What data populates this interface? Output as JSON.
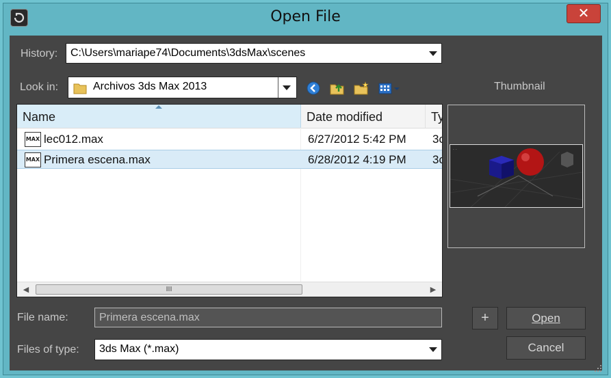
{
  "window": {
    "title": "Open File",
    "close_glyph": "✕",
    "app_icon": "3ds-max-app-icon"
  },
  "history": {
    "label": "History:",
    "value": "C:\\Users\\mariape74\\Documents\\3dsMax\\scenes"
  },
  "look_in": {
    "label": "Look in:",
    "value": "Archivos 3ds Max 2013",
    "folder_icon": "folder-icon"
  },
  "toolbar": {
    "icons": [
      "back-icon",
      "up-folder-icon",
      "new-folder-icon",
      "view-menu-icon"
    ]
  },
  "file_list": {
    "columns": [
      "Name",
      "Date modified",
      "Ty"
    ],
    "rows": [
      {
        "name": "lec012.max",
        "date": "6/27/2012 5:42 PM",
        "type": "3c",
        "icon_text": "MAX",
        "selected": false
      },
      {
        "name": "Primera escena.max",
        "date": "6/28/2012 4:19 PM",
        "type": "3c",
        "icon_text": "MAX",
        "selected": true
      }
    ],
    "scroll_thumb_glyph": "III"
  },
  "thumbnail": {
    "label": "Thumbnail"
  },
  "file_name": {
    "label": "File name:",
    "value": "Primera escena.max"
  },
  "files_of_type": {
    "label": "Files of type:",
    "value": "3ds Max (*.max)"
  },
  "buttons": {
    "plus": "+",
    "open": "Open",
    "cancel": "Cancel"
  },
  "colors": {
    "title_bar": "#6fc3d0",
    "client_bg": "#454545",
    "close_red": "#c9433a",
    "selection": "#d9ebf7"
  }
}
